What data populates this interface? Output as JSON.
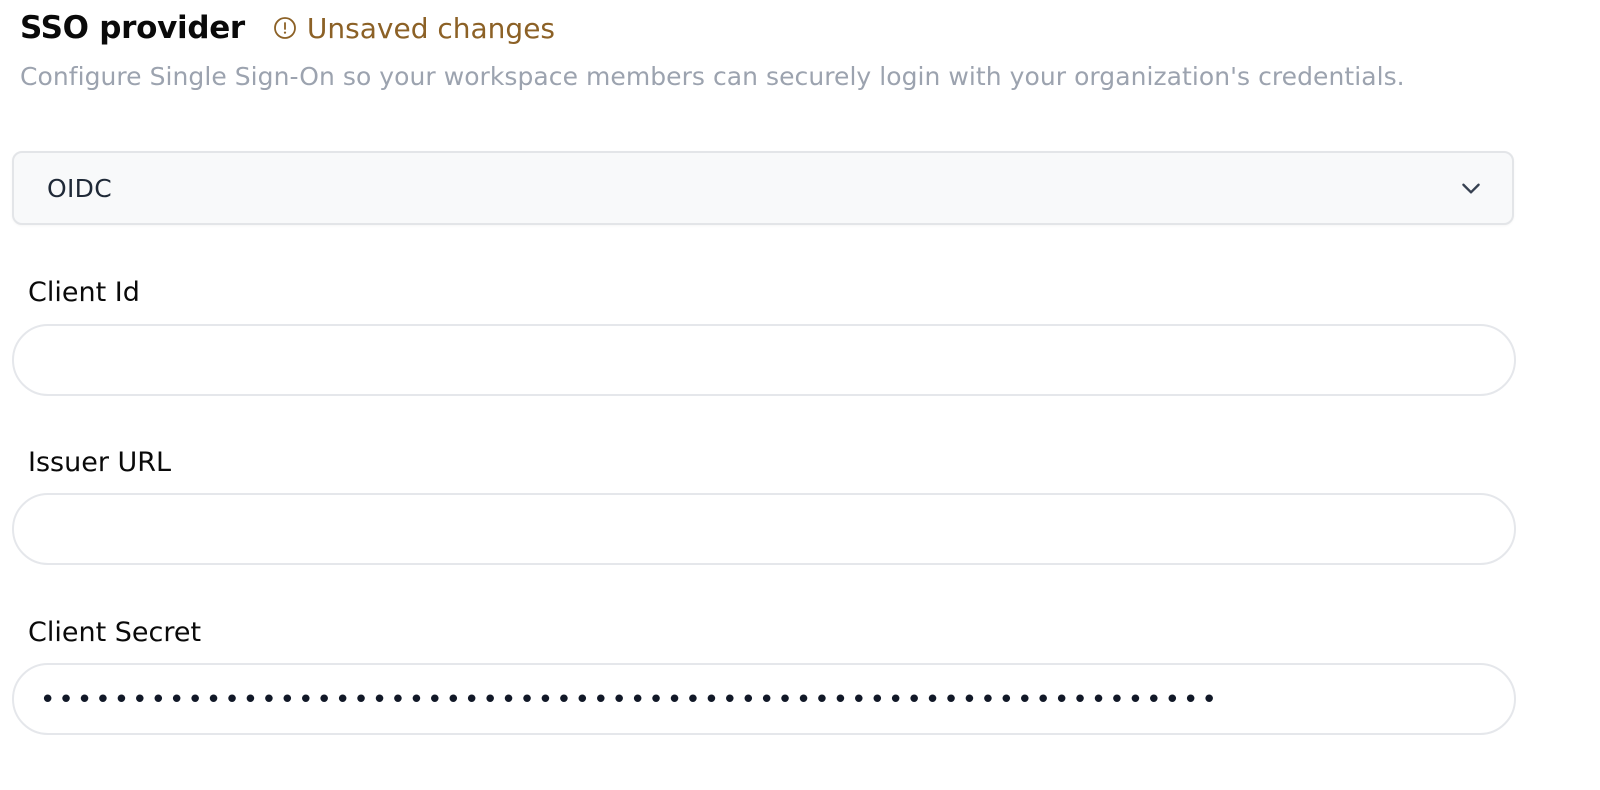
{
  "header": {
    "title": "SSO provider",
    "unsaved_label": "Unsaved changes",
    "unsaved_icon": "exclamation-circle-icon",
    "unsaved_color": "#8c6126"
  },
  "subtitle": "Configure Single Sign-On so your workspace members can securely login with your organization's credentials.",
  "provider_select": {
    "value": "OIDC",
    "icon": "chevron-down-icon"
  },
  "fields": {
    "client_id": {
      "label": "Client Id",
      "value": ""
    },
    "issuer_url": {
      "label": "Issuer URL",
      "value": ""
    },
    "client_secret": {
      "label": "Client Secret",
      "masked_value": "••••••••••••••••••••••••••••••••••••••••••••••••••••••••••••••••"
    }
  }
}
